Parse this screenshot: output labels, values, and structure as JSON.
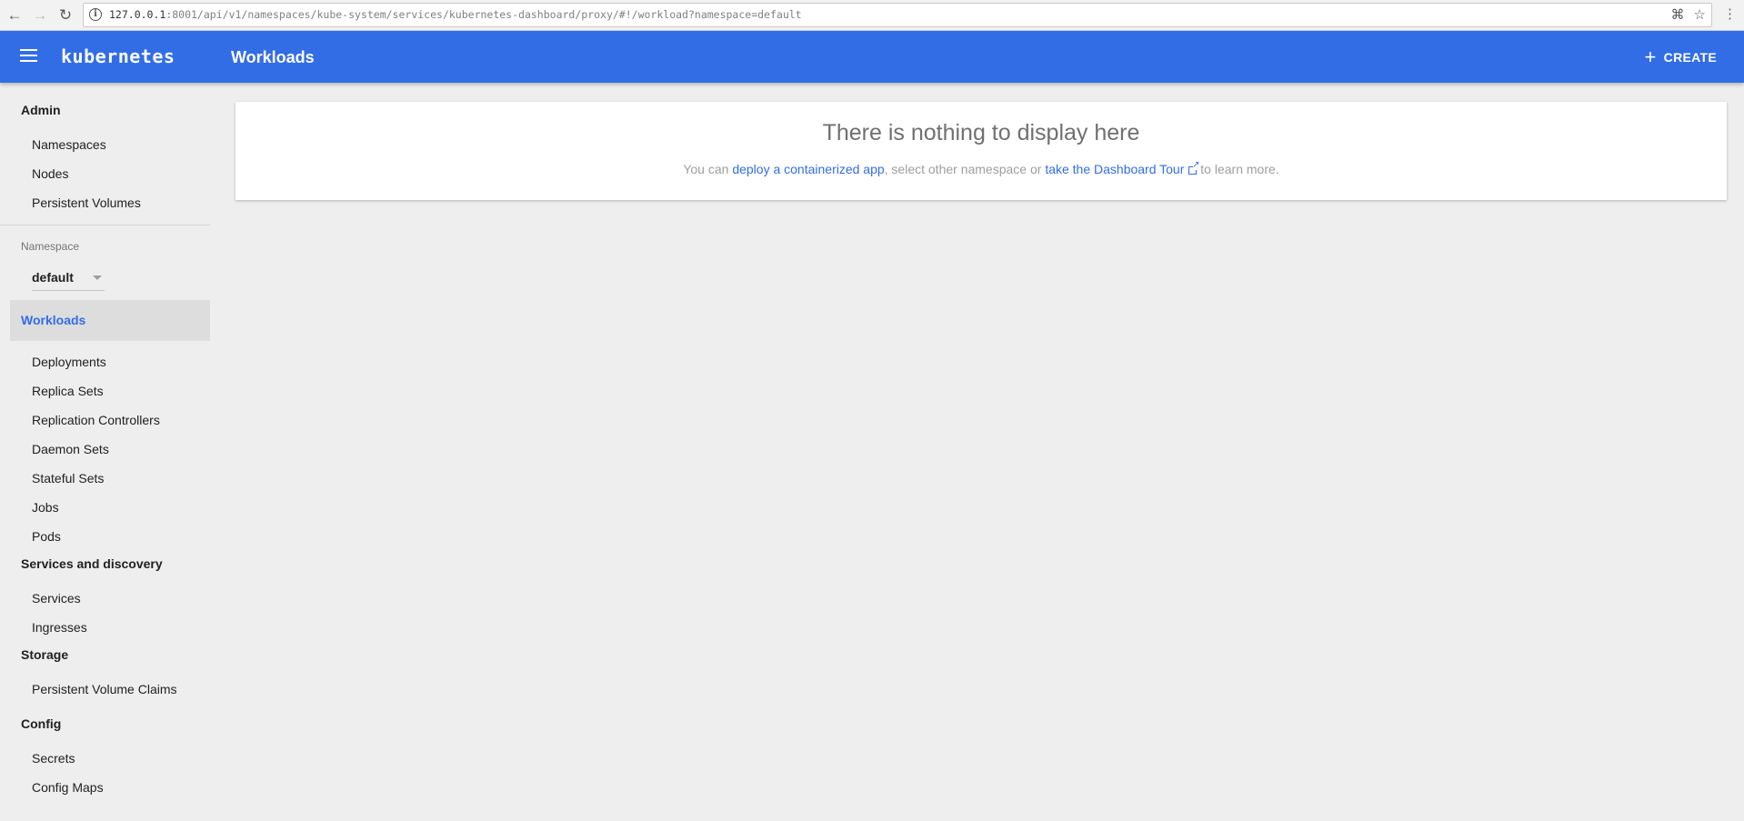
{
  "browser": {
    "back_icon": "←",
    "forward_icon": "→",
    "reload_icon": "↻",
    "url_host": "127.0.0.1",
    "url_rest": ":8001/api/v1/namespaces/kube-system/services/kubernetes-dashboard/proxy/#!/workload?namespace=default",
    "translate_icon": "⌘",
    "star_icon": "☆",
    "menu_icon": "⋮"
  },
  "toolbar": {
    "brand": "kubernetes",
    "title": "Workloads",
    "create_label": "CREATE",
    "create_icon": "+"
  },
  "sidebar": {
    "admin_heading": "Admin",
    "admin_items": [
      "Namespaces",
      "Nodes",
      "Persistent Volumes"
    ],
    "namespace_label": "Namespace",
    "namespace_value": "default",
    "workloads_heading": "Workloads",
    "workloads_items": [
      "Deployments",
      "Replica Sets",
      "Replication Controllers",
      "Daemon Sets",
      "Stateful Sets",
      "Jobs",
      "Pods"
    ],
    "services_heading": "Services and discovery",
    "services_items": [
      "Services",
      "Ingresses"
    ],
    "storage_heading": "Storage",
    "storage_items": [
      "Persistent Volume Claims"
    ],
    "config_heading": "Config",
    "config_items": [
      "Secrets",
      "Config Maps"
    ]
  },
  "main": {
    "empty_title": "There is nothing to display here",
    "text_1": "You can ",
    "link_1": "deploy a containerized app",
    "text_2": ", select other namespace or ",
    "link_2": "take the Dashboard Tour",
    "text_3": " to learn more."
  },
  "colors": {
    "accent": "#326de6",
    "background": "#eeeeee"
  }
}
